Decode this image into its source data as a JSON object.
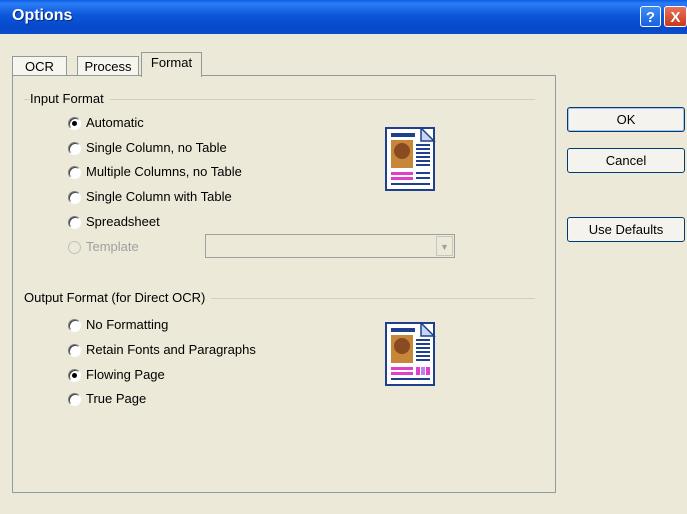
{
  "window": {
    "title": "Options"
  },
  "titlebar": {
    "help_glyph": "?",
    "close_glyph": "X"
  },
  "tabs": [
    {
      "label": "OCR",
      "selected": false
    },
    {
      "label": "Process",
      "selected": false
    },
    {
      "label": "Format",
      "selected": true
    }
  ],
  "input_format": {
    "label": "Input Format",
    "options": [
      {
        "label": "Automatic",
        "checked": true,
        "enabled": true
      },
      {
        "label": "Single Column, no Table",
        "checked": false,
        "enabled": true
      },
      {
        "label": "Multiple Columns, no Table",
        "checked": false,
        "enabled": true
      },
      {
        "label": "Single Column with Table",
        "checked": false,
        "enabled": true
      },
      {
        "label": "Spreadsheet",
        "checked": false,
        "enabled": true
      },
      {
        "label": "Template",
        "checked": false,
        "enabled": false
      }
    ],
    "template_select": {
      "value": ""
    }
  },
  "output_format": {
    "label": "Output Format (for Direct OCR)",
    "options": [
      {
        "label": "No Formatting",
        "checked": false,
        "enabled": true
      },
      {
        "label": "Retain Fonts and Paragraphs",
        "checked": false,
        "enabled": true
      },
      {
        "label": "Flowing Page",
        "checked": true,
        "enabled": true
      },
      {
        "label": "True Page",
        "checked": false,
        "enabled": true
      }
    ]
  },
  "buttons": {
    "ok": "OK",
    "cancel": "Cancel",
    "use_defaults": "Use Defaults"
  },
  "colors": {
    "titlebar": "#0b56d9",
    "window_bg": "#ece9d8",
    "button_border": "#003c74",
    "icon_blue": "#1f3f8f",
    "icon_pink": "#e040c8"
  },
  "icons": {
    "input_preview": "document-preview-icon",
    "output_preview": "document-preview-icon"
  }
}
